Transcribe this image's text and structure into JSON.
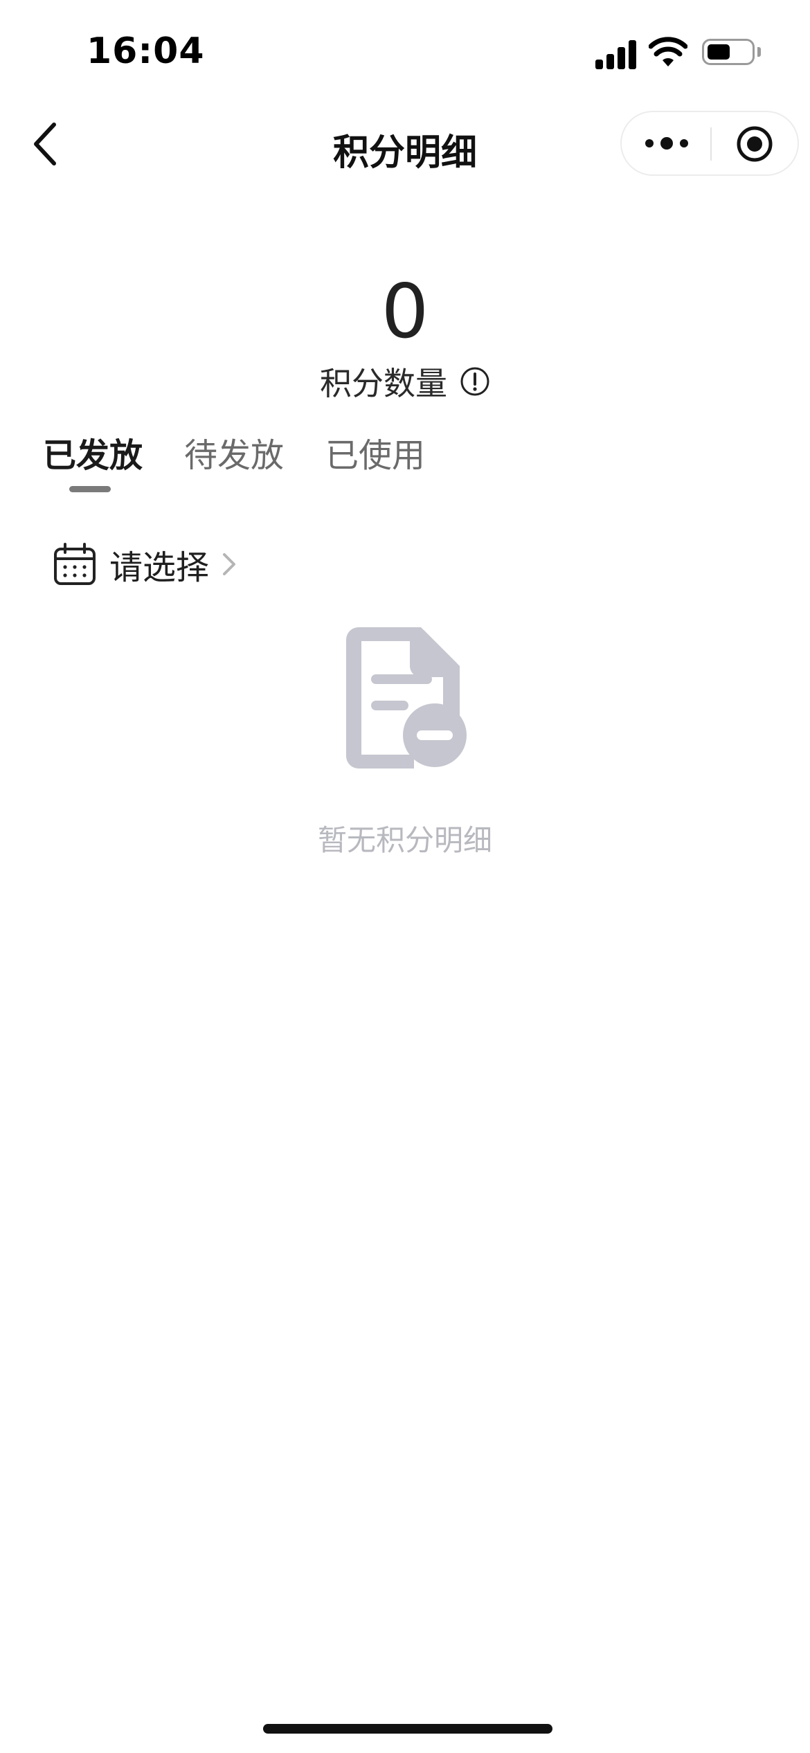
{
  "status_bar": {
    "time": "16:04",
    "icons": [
      "cellular-signal-icon",
      "wifi-icon",
      "battery-icon"
    ]
  },
  "nav": {
    "title": "积分明细",
    "icons": [
      "chevron-left-icon",
      "more-dots-icon",
      "target-icon"
    ]
  },
  "summary": {
    "points_value": "0",
    "points_label": "积分数量",
    "info_icon": "info-circle-icon"
  },
  "tabs": [
    {
      "label": "已发放",
      "active": true
    },
    {
      "label": "待发放",
      "active": false
    },
    {
      "label": "已使用",
      "active": false
    }
  ],
  "filter": {
    "date_label": "请选择",
    "icons": [
      "calendar-icon",
      "chevron-right-icon"
    ]
  },
  "empty_state": {
    "icon": "document-minus-icon",
    "text": "暂无积分明细"
  },
  "colors": {
    "text_primary": "#1f1f1f",
    "text_secondary": "#6a6a6a",
    "empty_icon": "#c5c6cf",
    "empty_text": "#b8b9bf",
    "tab_indicator": "#7a7a7a"
  }
}
